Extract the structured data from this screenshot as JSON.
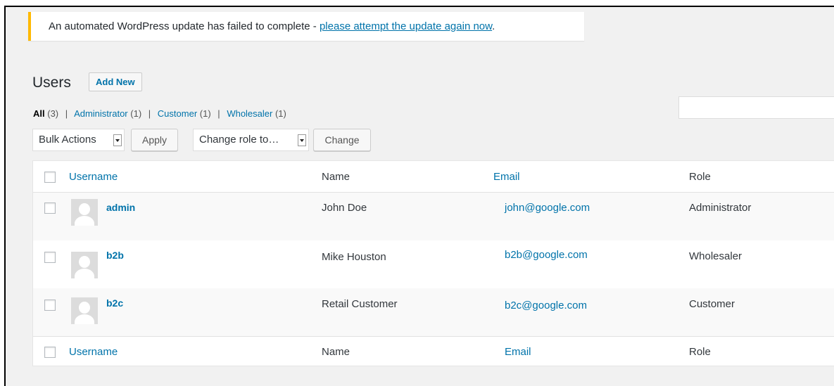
{
  "notice": {
    "text": "An automated WordPress update has failed to complete - ",
    "link_text": "please attempt the update again now",
    "end": "."
  },
  "page": {
    "title": "Users",
    "add_new_label": "Add New"
  },
  "views": [
    {
      "label": "All",
      "count": "(3)"
    },
    {
      "label": "Administrator",
      "count": "(1)"
    },
    {
      "label": "Customer",
      "count": "(1)"
    },
    {
      "label": "Wholesaler",
      "count": "(1)"
    }
  ],
  "separator": "|",
  "search": {
    "value": ""
  },
  "actions": {
    "bulk_select": "Bulk Actions",
    "apply_label": "Apply",
    "role_select": "Change role to…",
    "change_label": "Change"
  },
  "table": {
    "columns": {
      "username": "Username",
      "name": "Name",
      "email": "Email",
      "role": "Role"
    },
    "rows": [
      {
        "username": "admin",
        "name": "John Doe",
        "email": "john@google.com",
        "role": "Administrator"
      },
      {
        "username": "b2b",
        "name": "Mike Houston",
        "email": "b2b@google.com",
        "role": "Wholesaler"
      },
      {
        "username": "b2c",
        "name": "Retail Customer",
        "email": "b2c@google.com",
        "role": "Customer"
      }
    ]
  },
  "colors": {
    "accent": "#0073aa",
    "notice_border": "#ffb900",
    "background": "#f1f1f1"
  }
}
